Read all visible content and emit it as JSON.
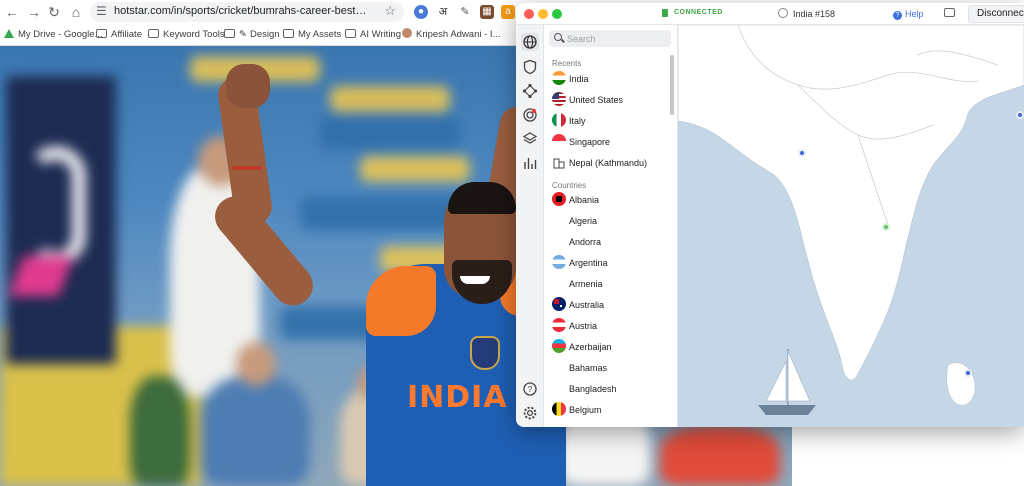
{
  "browser": {
    "url": "hotstar.com/in/sports/cricket/bumrahs-career-best-jolts-afghan...",
    "nav": {
      "back_icon": "back-arrow-icon",
      "forward_icon": "forward-arrow-icon",
      "reload_icon": "reload-icon",
      "home_icon": "home-icon"
    },
    "extensions": [
      "translate-icon",
      "hindi-icon",
      "pen-icon",
      "screenshot-icon",
      "amazon-icon"
    ],
    "extension_glyphs": {
      "hindi": "अ",
      "amazon": "a"
    },
    "bookmarks": [
      {
        "label": "My Drive - Google..."
      },
      {
        "label": "Affiliate"
      },
      {
        "label": "Keyword Tools"
      },
      {
        "label": "Design"
      },
      {
        "label": "My Assets"
      },
      {
        "label": "AI Writing"
      },
      {
        "label": "Kripesh Adwani - I..."
      }
    ]
  },
  "photo": {
    "jersey_text": "INDIA"
  },
  "vpn": {
    "status": "CONNECTED",
    "server": "India #158",
    "help_label": "Help",
    "disconnect_label": "Disconnect",
    "search_placeholder": "Search",
    "recents_header": "Recents",
    "countries_header": "Countries",
    "recents": [
      {
        "label": "India",
        "flag": "in"
      },
      {
        "label": "United States",
        "flag": "us"
      },
      {
        "label": "Italy",
        "flag": "it"
      },
      {
        "label": "Singapore",
        "flag": "sg"
      },
      {
        "label": "Nepal (Kathmandu)",
        "flag": "city"
      }
    ],
    "countries": [
      {
        "label": "Albania",
        "flag": "al"
      },
      {
        "label": "Algeria",
        "flag": ""
      },
      {
        "label": "Andorra",
        "flag": ""
      },
      {
        "label": "Argentina",
        "flag": "ar"
      },
      {
        "label": "Armenia",
        "flag": ""
      },
      {
        "label": "Australia",
        "flag": "au"
      },
      {
        "label": "Austria",
        "flag": "at"
      },
      {
        "label": "Azerbaijan",
        "flag": "az"
      },
      {
        "label": "Bahamas",
        "flag": ""
      },
      {
        "label": "Bangladesh",
        "flag": ""
      },
      {
        "label": "Belgium",
        "flag": "be"
      }
    ],
    "rail_icons": [
      "globe-icon",
      "shield-icon",
      "meshnet-icon",
      "target-icon",
      "layers-icon",
      "stats-icon",
      "help-circle-icon",
      "settings-gear-icon"
    ],
    "colors": {
      "connected": "#3fa745",
      "map_sea": "#c5d6e6",
      "map_land": "#ffffff",
      "server_pin": "#4466d6",
      "help_link": "#3b6fe0"
    }
  }
}
